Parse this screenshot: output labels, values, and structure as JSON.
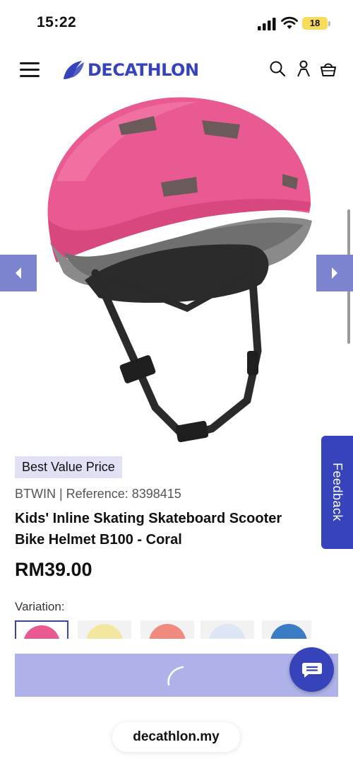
{
  "status_bar": {
    "time": "15:22",
    "battery_level": "18"
  },
  "header": {
    "logo_text": "DECATHLON",
    "brand_color": "#3643ba",
    "icons": [
      "menu-icon",
      "search-icon",
      "account-icon",
      "cart-icon"
    ]
  },
  "gallery": {
    "helmet_color": "#e95a92",
    "prev_icon": "chevron-left-icon",
    "next_icon": "chevron-right-icon"
  },
  "feedback": {
    "label": "Feedback"
  },
  "product": {
    "badge": "Best Value Price",
    "reference": "BTWIN | Reference: 8398415",
    "title": "Kids' Inline Skating Skateboard Scooter Bike Helmet B100 - Coral",
    "price": "RM39.00",
    "variation_label": "Variation:",
    "variations": [
      {
        "color": "#e95a92",
        "selected": true
      },
      {
        "color": "#f3e7a0",
        "selected": false
      },
      {
        "color": "#f08a7e",
        "selected": false
      },
      {
        "color": "#dde6f4",
        "selected": false
      },
      {
        "color": "#3a7dc4",
        "selected": false
      }
    ]
  },
  "cart_button": {
    "state": "loading",
    "icon": "loading-spinner-icon"
  },
  "chat_button": {
    "icon": "chat-icon"
  },
  "browser": {
    "url": "decathlon.my"
  }
}
